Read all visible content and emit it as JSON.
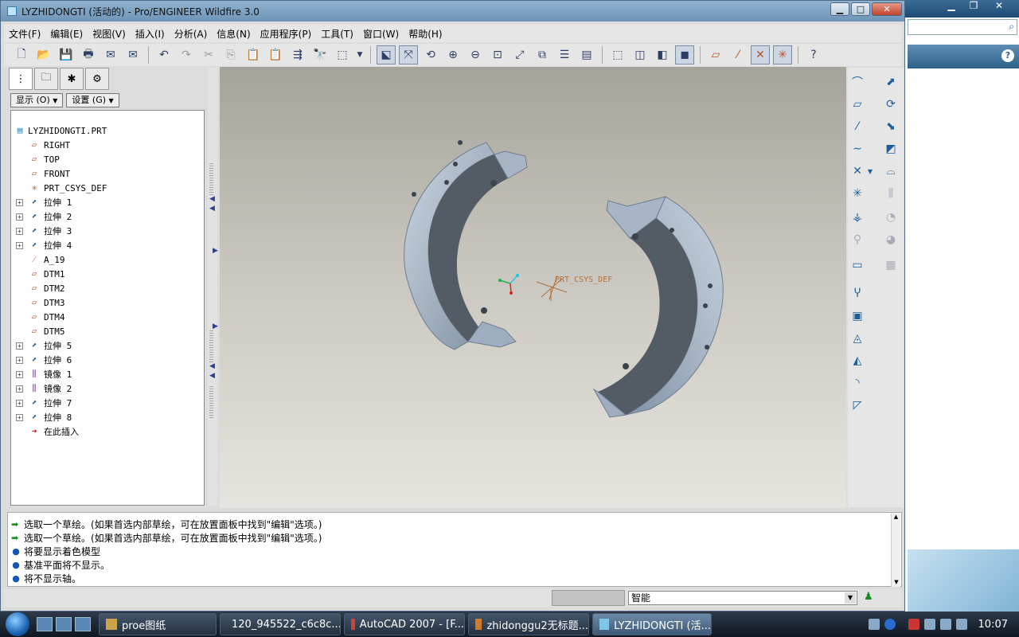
{
  "window": {
    "title": "LYZHIDONGTI (活动的) - Pro/ENGINEER Wildfire 3.0"
  },
  "menu": [
    "文件(F)",
    "编辑(E)",
    "视图(V)",
    "插入(I)",
    "分析(A)",
    "信息(N)",
    "应用程序(P)",
    "工具(T)",
    "窗口(W)",
    "帮助(H)"
  ],
  "panel": {
    "show_label": "显示 (O)",
    "settings_label": "设置 (G)"
  },
  "tree": [
    {
      "label": "LYZHIDONGTI.PRT",
      "icon": "part-icon",
      "expand": false,
      "root": true
    },
    {
      "label": "RIGHT",
      "icon": "datum-plane-icon",
      "expand": false
    },
    {
      "label": "TOP",
      "icon": "datum-plane-icon",
      "expand": false
    },
    {
      "label": "FRONT",
      "icon": "datum-plane-icon",
      "expand": false
    },
    {
      "label": "PRT_CSYS_DEF",
      "icon": "csys-icon",
      "expand": false
    },
    {
      "label": "拉伸 1",
      "icon": "extrude-icon",
      "expand": true
    },
    {
      "label": "拉伸 2",
      "icon": "extrude-icon",
      "expand": true
    },
    {
      "label": "拉伸 3",
      "icon": "extrude-icon",
      "expand": true
    },
    {
      "label": "拉伸 4",
      "icon": "extrude-icon",
      "expand": true
    },
    {
      "label": "A_19",
      "icon": "axis-icon",
      "expand": false
    },
    {
      "label": "DTM1",
      "icon": "datum-plane-icon",
      "expand": false
    },
    {
      "label": "DTM2",
      "icon": "datum-plane-icon",
      "expand": false
    },
    {
      "label": "DTM3",
      "icon": "datum-plane-icon",
      "expand": false
    },
    {
      "label": "DTM4",
      "icon": "datum-plane-icon",
      "expand": false
    },
    {
      "label": "DTM5",
      "icon": "datum-plane-icon",
      "expand": false
    },
    {
      "label": "拉伸 5",
      "icon": "extrude-icon",
      "expand": true
    },
    {
      "label": "拉伸 6",
      "icon": "extrude-icon",
      "expand": true
    },
    {
      "label": "镜像 1",
      "icon": "mirror-icon",
      "expand": true
    },
    {
      "label": "镜像 2",
      "icon": "mirror-icon",
      "expand": true
    },
    {
      "label": "拉伸 7",
      "icon": "extrude-icon",
      "expand": true
    },
    {
      "label": "拉伸 8",
      "icon": "extrude-icon",
      "expand": true
    },
    {
      "label": "在此插入",
      "icon": "insert-here-icon",
      "expand": false
    }
  ],
  "viewport": {
    "csys_label": "PRT_CSYS_DEF"
  },
  "messages": [
    {
      "type": "prompt",
      "text": "选取一个草绘。(如果首选内部草绘，可在放置面板中找到\"编辑\"选项。)"
    },
    {
      "type": "prompt",
      "text": "选取一个草绘。(如果首选内部草绘，可在放置面板中找到\"编辑\"选项。)"
    },
    {
      "type": "info",
      "text": "将要显示着色模型"
    },
    {
      "type": "info",
      "text": "基准平面将不显示。"
    },
    {
      "type": "info",
      "text": "将不显示轴。"
    }
  ],
  "status": {
    "filter_value": "智能"
  },
  "taskbar": {
    "items": [
      {
        "label": "proe图纸",
        "active": false
      },
      {
        "label": "120_945522_c6c8c...",
        "active": false
      },
      {
        "label": "AutoCAD 2007 - [F...",
        "active": false
      },
      {
        "label": "zhidonggu2无标题...",
        "active": false
      },
      {
        "label": "LYZHIDONGTI (活...",
        "active": true
      }
    ],
    "clock": "10:07"
  },
  "colors": {
    "accent": "#1e5d96",
    "viewport_top": "#a6a39a",
    "viewport_bottom": "#e6e4de",
    "part_light": "#a9b7c8",
    "part_dark": "#525a63"
  }
}
